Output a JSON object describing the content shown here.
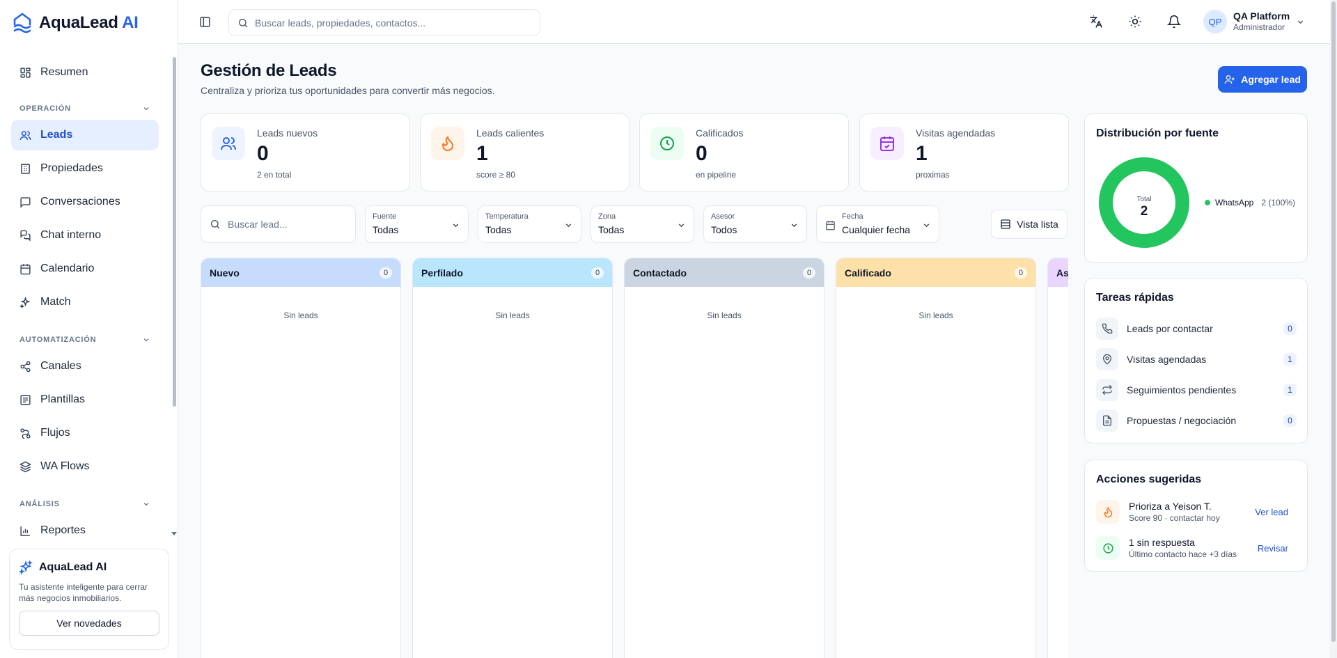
{
  "brand": {
    "name": "AquaLead",
    "suffix": "AI"
  },
  "sidebar": {
    "items": [
      {
        "label": "Resumen",
        "icon": "dashboard-icon"
      },
      {
        "label": "Leads",
        "icon": "users-icon",
        "active": true
      },
      {
        "label": "Propiedades",
        "icon": "building-icon"
      },
      {
        "label": "Conversaciones",
        "icon": "chat-icon"
      },
      {
        "label": "Chat interno",
        "icon": "messages-icon"
      },
      {
        "label": "Calendario",
        "icon": "calendar-icon"
      },
      {
        "label": "Match",
        "icon": "sparkles-icon"
      },
      {
        "label": "Canales",
        "icon": "share-icon"
      },
      {
        "label": "Plantillas",
        "icon": "template-icon"
      },
      {
        "label": "Flujos",
        "icon": "flow-icon"
      },
      {
        "label": "WA Flows",
        "icon": "layers-icon"
      },
      {
        "label": "Reportes",
        "icon": "bar-chart-icon"
      }
    ],
    "sections": [
      "OPERACIÓN",
      "AUTOMATIZACIÓN",
      "ANÁLISIS"
    ],
    "ai_card": {
      "title": "AquaLead AI",
      "text": "Tu asistente inteligente para cerrar más negocios inmobiliarios.",
      "button": "Ver novedades"
    }
  },
  "topbar": {
    "search_placeholder": "Buscar leads, propiedades, contactos...",
    "user_initials": "QP",
    "user_name": "QA Platform",
    "user_role": "Administrador"
  },
  "page": {
    "title": "Gestión de Leads",
    "subtitle": "Centraliza y prioriza tus oportunidades para convertir más negocios.",
    "add_button": "Agregar lead"
  },
  "stats": [
    {
      "label": "Leads nuevos",
      "value": "0",
      "sub": "2 en total"
    },
    {
      "label": "Leads calientes",
      "value": "1",
      "sub": "score ≥ 80"
    },
    {
      "label": "Calificados",
      "value": "0",
      "sub": "en pipeline"
    },
    {
      "label": "Visitas agendadas",
      "value": "1",
      "sub": "proximas"
    }
  ],
  "filters": {
    "search_placeholder": "Buscar lead...",
    "fuente": {
      "label": "Fuente",
      "value": "Todas"
    },
    "temperatura": {
      "label": "Temperatura",
      "value": "Todas"
    },
    "zona": {
      "label": "Zona",
      "value": "Todas"
    },
    "asesor": {
      "label": "Asesor",
      "value": "Todos"
    },
    "fecha": {
      "label": "Fecha",
      "value": "Cualquier fecha"
    },
    "view_toggle": "Vista lista"
  },
  "board": {
    "columns": [
      {
        "title": "Nuevo",
        "count": "0",
        "empty": "Sin leads",
        "color": "#c7dcfd"
      },
      {
        "title": "Perfilado",
        "count": "0",
        "empty": "Sin leads",
        "color": "#bae6fd"
      },
      {
        "title": "Contactado",
        "count": "0",
        "empty": "Sin leads",
        "color": "#cbd5e1"
      },
      {
        "title": "Calificado",
        "count": "0",
        "empty": "Sin leads",
        "color": "#fde1a8"
      },
      {
        "title": "As",
        "color": "#e9d5ff"
      }
    ]
  },
  "distribution": {
    "title": "Distribución por fuente",
    "total_label": "Total",
    "total_value": "2",
    "legend": [
      {
        "name": "WhatsApp",
        "value": "2 (100%)",
        "color": "#22c55e",
        "share": 1.0
      }
    ]
  },
  "tasks": {
    "title": "Tareas rápidas",
    "items": [
      {
        "label": "Leads por contactar",
        "count": "0",
        "icon": "phone-icon"
      },
      {
        "label": "Visitas agendadas",
        "count": "1",
        "icon": "map-pin-icon"
      },
      {
        "label": "Seguimientos pendientes",
        "count": "1",
        "icon": "repeat-icon"
      },
      {
        "label": "Propuestas / negociación",
        "count": "0",
        "icon": "document-icon"
      }
    ]
  },
  "suggestions": {
    "title": "Acciones sugeridas",
    "items": [
      {
        "title": "Prioriza a Yeison T.",
        "sub": "Score 90 · contactar hoy",
        "action": "Ver lead",
        "icon": "flame-icon"
      },
      {
        "title": "1 sin respuesta",
        "sub": "Último contacto hace +3 días",
        "action": "Revisar",
        "icon": "clock-icon"
      }
    ]
  },
  "colors": {
    "primary": "#2563eb",
    "success": "#22c55e",
    "hot": "#f97316",
    "visit": "#9333ea"
  }
}
